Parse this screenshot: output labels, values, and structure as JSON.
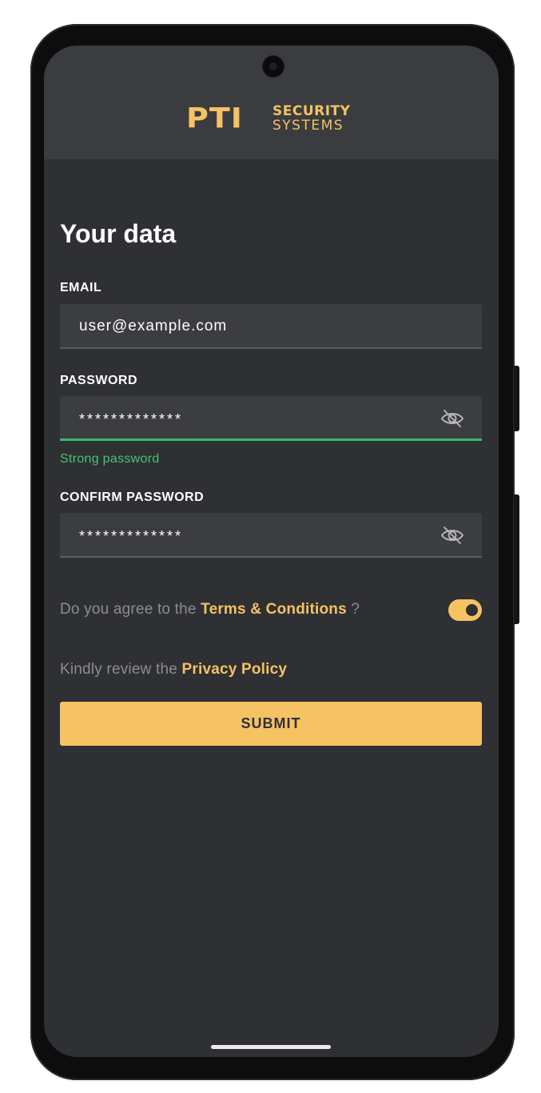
{
  "brand": {
    "logo_mark": "PTI",
    "logo_line1": "SECURITY",
    "logo_line2": "SYSTEMS",
    "accent_color": "#f5c264"
  },
  "page": {
    "title": "Your data"
  },
  "email": {
    "label": "EMAIL",
    "value": "user@example.com"
  },
  "password": {
    "label": "PASSWORD",
    "value": "*************",
    "visibility_icon": "eye-off-icon",
    "strength_text": "Strong password",
    "strength_color": "#36bb6a"
  },
  "confirm_password": {
    "label": "CONFIRM PASSWORD",
    "value": "*************",
    "visibility_icon": "eye-off-icon"
  },
  "terms": {
    "prefix": "Do you agree to the ",
    "link": "Terms & Conditions",
    "suffix": " ?",
    "toggle_on": true
  },
  "privacy": {
    "prefix": "Kindly review the ",
    "link": "Privacy Policy"
  },
  "submit": {
    "label": "SUBMIT"
  }
}
